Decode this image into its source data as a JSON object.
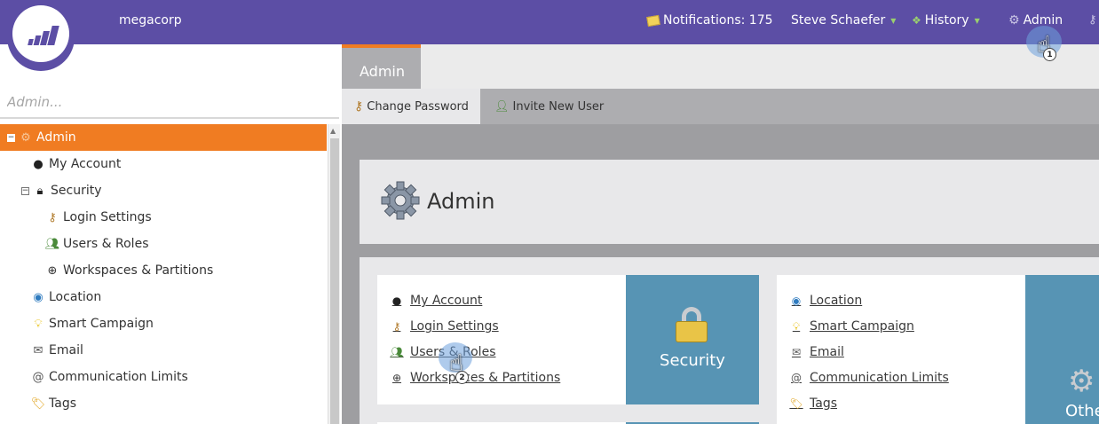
{
  "topbar": {
    "company": "megacorp",
    "notifications": "Notifications: 175",
    "user": "Steve Schaefer",
    "history": "History",
    "admin": "Admin"
  },
  "sidebar": {
    "search_placeholder": "Admin...",
    "items": [
      {
        "label": "Admin"
      },
      {
        "label": "My Account"
      },
      {
        "label": "Security"
      },
      {
        "label": "Login Settings"
      },
      {
        "label": "Users & Roles"
      },
      {
        "label": "Workspaces & Partitions"
      },
      {
        "label": "Location"
      },
      {
        "label": "Smart Campaign"
      },
      {
        "label": "Email"
      },
      {
        "label": "Communication Limits"
      },
      {
        "label": "Tags"
      }
    ]
  },
  "main": {
    "tab": "Admin",
    "toolbar": {
      "change_password": "Change Password",
      "invite_user": "Invite New User"
    },
    "header_title": "Admin",
    "security_card": {
      "title": "Security",
      "links": [
        "My Account",
        "Login Settings",
        "Users & Roles",
        "Workspaces & Partitions"
      ]
    },
    "other_card": {
      "title": "Other",
      "links": [
        "Location",
        "Smart Campaign",
        "Email",
        "Communication Limits",
        "Tags"
      ]
    }
  },
  "annotations": {
    "step1": "1",
    "step2": "2"
  }
}
